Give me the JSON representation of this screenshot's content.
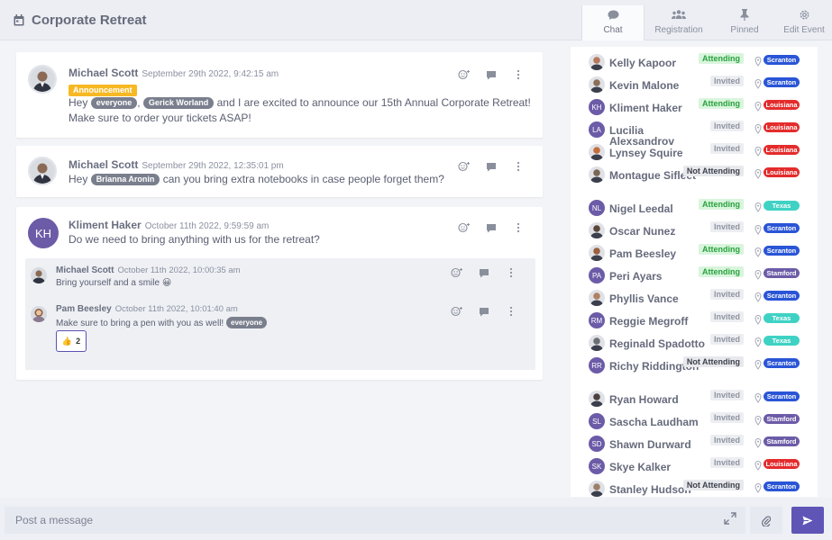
{
  "header": {
    "title": "Corporate Retreat",
    "tabs": [
      {
        "label": "Chat",
        "icon": "chat-bubble-icon",
        "active": true
      },
      {
        "label": "Registration",
        "icon": "people-icon"
      },
      {
        "label": "Pinned",
        "icon": "pin-icon"
      },
      {
        "label": "Edit Event",
        "icon": "gear-icon"
      }
    ]
  },
  "messages": [
    {
      "author": "Michael Scott",
      "time": "September 29th 2022, 9:42:15 am",
      "badge": "Announcement",
      "text_1": "Hey",
      "mention_1": "everyone",
      "text_2": ",",
      "mention_2": "Gerick Worland",
      "text_3": "and I are excited to announce our 15th Annual Corporate Retreat!",
      "text_4": "Make sure to order your tickets ASAP!"
    },
    {
      "author": "Michael Scott",
      "time": "September 29th 2022, 12:35:01 pm",
      "text_1": "Hey",
      "mention_1": "Brianna Aronin",
      "text_2": "can you bring extra notebooks in case people forget them?"
    },
    {
      "author": "Kliment Haker",
      "initials": "KH",
      "time": "October 11th 2022, 9:59:59 am",
      "text_1": "Do we need to bring anything with us for the retreat?"
    }
  ],
  "replies": [
    {
      "author": "Michael Scott",
      "time": "October 11th 2022, 10:00:35 am",
      "text": "Bring yourself and a smile 😀"
    },
    {
      "author": "Pam Beesley",
      "time": "October 11th 2022, 10:01:40 am",
      "text": "Make sure to bring a pen with you as well!",
      "mention": "everyone",
      "reaction_emoji": "👍",
      "reaction_count": "2"
    }
  ],
  "attendees": [
    {
      "name": "Kelly Kapoor",
      "status": "Attending",
      "location": "Scranton"
    },
    {
      "name": "Kevin Malone",
      "status": "Invited",
      "location": "Scranton"
    },
    {
      "name": "Kliment Haker",
      "initials": "KH",
      "status": "Attending",
      "location": "Louisiana"
    },
    {
      "name": "Lucilia Alexsandrov",
      "initials": "LA",
      "status": "Invited",
      "location": "Louisiana"
    },
    {
      "name": "Lynsey Squire",
      "status": "Invited",
      "location": "Louisiana"
    },
    {
      "name": "Montague Sifleet",
      "status": "Not Attending",
      "location": "Louisiana"
    },
    {
      "name": "Nigel Leedal",
      "initials": "NL",
      "status": "Attending",
      "location": "Texas"
    },
    {
      "name": "Oscar Nunez",
      "status": "Invited",
      "location": "Scranton"
    },
    {
      "name": "Pam Beesley",
      "status": "Attending",
      "location": "Scranton"
    },
    {
      "name": "Peri Ayars",
      "initials": "PA",
      "status": "Attending",
      "location": "Stamford"
    },
    {
      "name": "Phyllis Vance",
      "status": "Invited",
      "location": "Scranton"
    },
    {
      "name": "Reggie Megroff",
      "initials": "RM",
      "status": "Invited",
      "location": "Texas"
    },
    {
      "name": "Reginald Spadotto",
      "status": "Invited",
      "location": "Texas"
    },
    {
      "name": "Richy Riddington",
      "initials": "RR",
      "status": "Not Attending",
      "location": "Scranton"
    },
    {
      "name": "Ryan Howard",
      "status": "Invited",
      "location": "Scranton"
    },
    {
      "name": "Sascha Laudham",
      "initials": "SL",
      "status": "Invited",
      "location": "Stamford"
    },
    {
      "name": "Shawn Durward",
      "initials": "SD",
      "status": "Invited",
      "location": "Stamford"
    },
    {
      "name": "Skye Kalker",
      "initials": "SK",
      "status": "Invited",
      "location": "Louisiana"
    },
    {
      "name": "Stanley Hudson",
      "status": "Not Attending",
      "location": "Scranton"
    }
  ],
  "colors": {
    "Scranton": "#2a55d6",
    "Louisiana": "#e42c2c",
    "Texas": "#3fd2c4",
    "Stamford": "#6c5ba7",
    "accent": "#5f55b7"
  },
  "composer": {
    "placeholder": "Post a message"
  }
}
